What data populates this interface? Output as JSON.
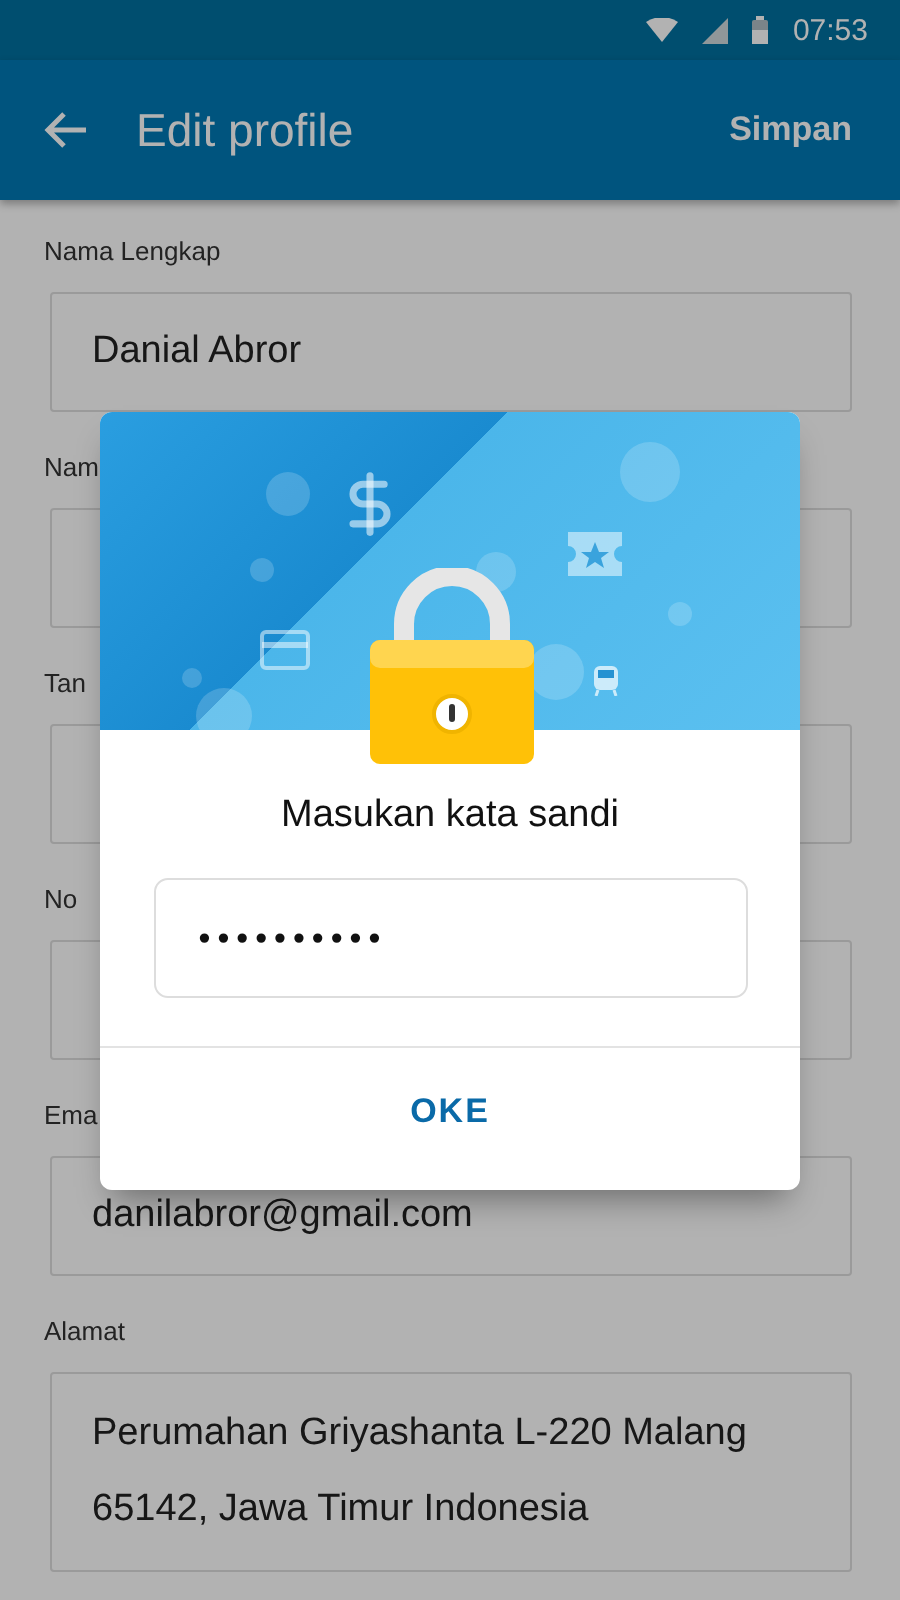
{
  "status_bar": {
    "time": "07:53"
  },
  "app_bar": {
    "title": "Edit profile",
    "action": "Simpan"
  },
  "fields": [
    {
      "label": "Nama Lengkap",
      "value": "Danial Abror"
    },
    {
      "label": "Nam"
    },
    {
      "label": "Tan"
    },
    {
      "label": "No"
    },
    {
      "label": "Ema",
      "value": "danilabror@gmail.com"
    },
    {
      "label": "Alamat",
      "value": "Perumahan Griyashanta L-220 Malang 65142, Jawa Timur Indonesia"
    }
  ],
  "dialog": {
    "title": "Masukan kata sandi",
    "password": "••••••••••",
    "button": "OKE"
  }
}
